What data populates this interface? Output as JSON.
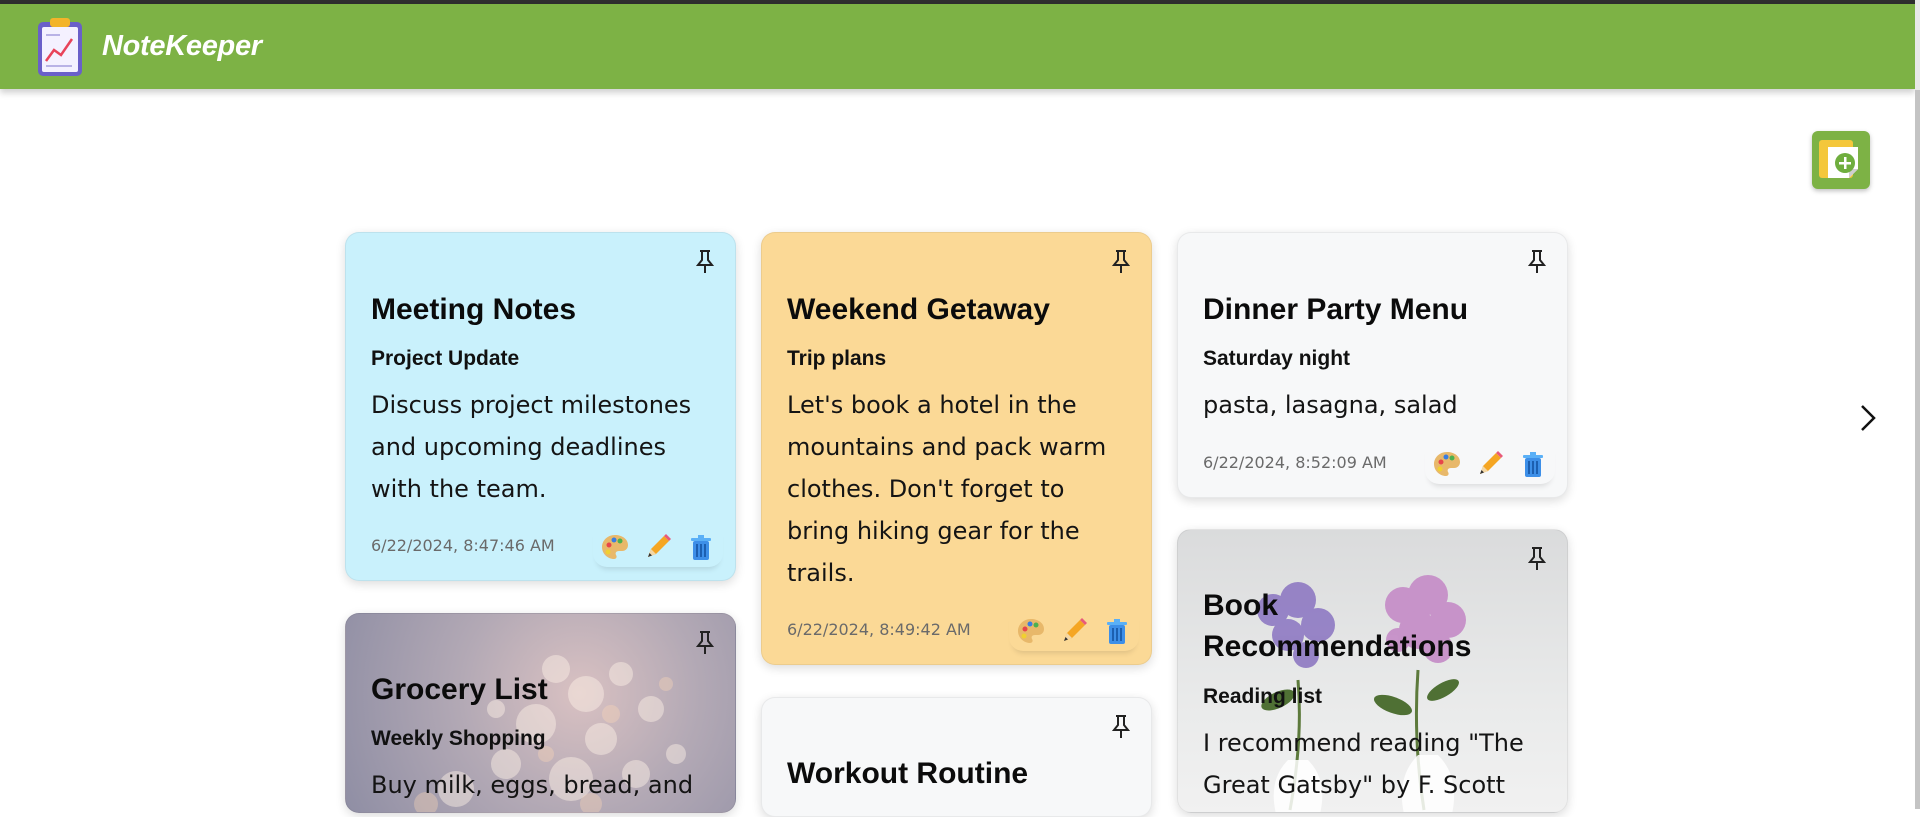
{
  "app": {
    "brand": "NoteKeeper"
  },
  "toolbar": {
    "add_note_icon": "add-note-icon",
    "next_icon": "chevron-right-icon"
  },
  "notes": [
    {
      "title": "Meeting Notes",
      "subtitle": "Project Update",
      "body": "Discuss project milestones and upcoming deadlines with the team.",
      "timestamp": "6/22/2024, 8:47:46 AM",
      "background": "#c9f1fc"
    },
    {
      "title": "Weekend Getaway",
      "subtitle": "Trip plans",
      "body": "Let's book a hotel in the mountains and pack warm clothes. Don't forget to bring hiking gear for the trails.",
      "timestamp": "6/22/2024, 8:49:42 AM",
      "background": "#fbd996"
    },
    {
      "title": "Dinner Party Menu",
      "subtitle": "Saturday night",
      "body": "pasta, lasagna, salad",
      "timestamp": "6/22/2024, 8:52:09 AM",
      "background": "#f7f8f9"
    },
    {
      "title": "Grocery List",
      "subtitle": "Weekly Shopping",
      "body": "Buy milk, eggs, bread, and",
      "background": "bokeh-image"
    },
    {
      "title": "Workout Routine",
      "background": "#f7f8f9"
    },
    {
      "title": "Book Recommendations",
      "subtitle": "Reading list",
      "body": "I recommend reading \"The Great Gatsby\" by F. Scott",
      "background": "flowers-image"
    }
  ],
  "colors": {
    "navbar": "#7db245",
    "accent": "#7db245"
  }
}
